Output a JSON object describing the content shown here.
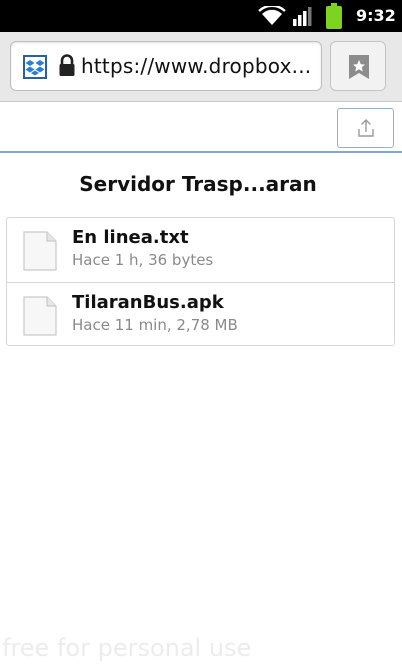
{
  "status_bar": {
    "time": "9:32",
    "icons": [
      "wifi-icon",
      "signal-icon",
      "battery-icon"
    ],
    "battery_color": "#7ed321"
  },
  "browser": {
    "url": "https://www.dropbox...",
    "favicon": "dropbox-icon",
    "security_icon": "lock-icon",
    "bookmark_icon": "bookmark-star-icon"
  },
  "action_bar": {
    "upload_icon": "upload-icon",
    "accent_color": "#7fa7cf"
  },
  "folder": {
    "title": "Servidor Trasp...aran"
  },
  "files": [
    {
      "name": "En linea.txt",
      "meta": "Hace 1 h, 36 bytes",
      "icon": "file-icon"
    },
    {
      "name": "TilaranBus.apk",
      "meta": "Hace 11 min, 2,78 MB",
      "icon": "file-icon"
    }
  ],
  "watermark": "free for personal use"
}
